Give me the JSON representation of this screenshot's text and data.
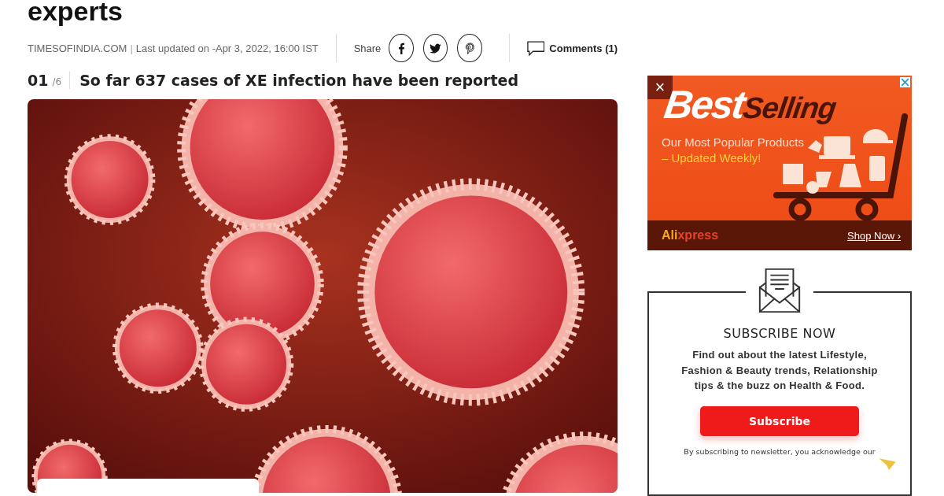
{
  "headline_tail": "experts",
  "meta": {
    "source": "TIMESOFINDIA.COM",
    "separator": "|",
    "updated": "Last updated on -Apr 3, 2022, 16:00 IST",
    "share_label": "Share",
    "share_buttons": [
      {
        "kind": "facebook"
      },
      {
        "kind": "twitter"
      },
      {
        "kind": "pinterest"
      }
    ],
    "comments": "Comments (1)"
  },
  "slide": {
    "number": "01",
    "total": "/6",
    "title": "So far 637 cases of XE infection have been reported"
  },
  "ad": {
    "close": "×",
    "title_a": "Best",
    "title_b": "Selling",
    "line_1": "Our Most Popular Products",
    "line_2": "– Updated Weekly!",
    "brand_a": "Ali",
    "brand_b": "xpress",
    "cta": "Shop Now ›"
  },
  "newsletter": {
    "title": "SUBSCRIBE NOW",
    "text": "Find out about the latest Lifestyle, Fashion & Beauty trends, Relationship tips & the buzz on Health & Food.",
    "button": "Subscribe",
    "note": "By subscribing to newsletter, you acknowledge our"
  }
}
